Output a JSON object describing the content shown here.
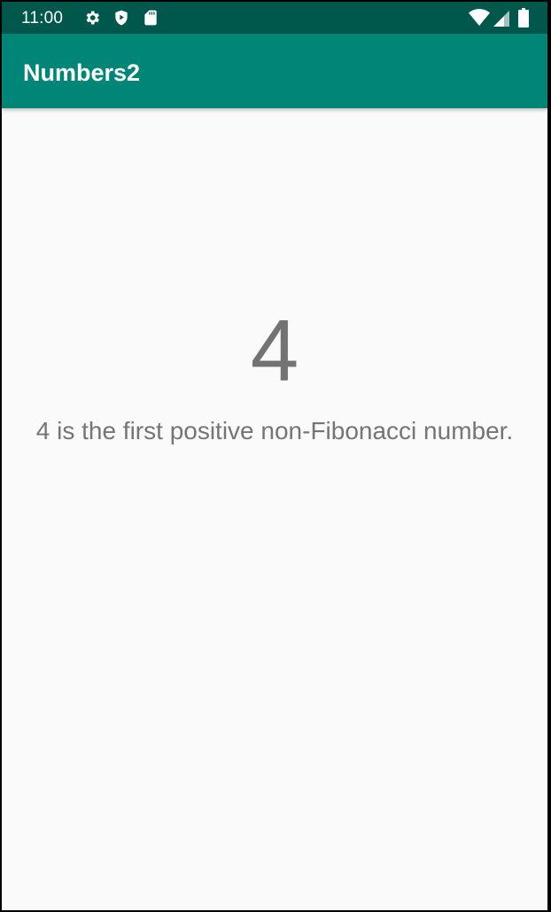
{
  "status_bar": {
    "time": "11:00",
    "icons": [
      "settings-icon",
      "shield-play-icon",
      "sd-card-icon",
      "wifi-icon",
      "signal-icon",
      "battery-icon"
    ]
  },
  "app_bar": {
    "title": "Numbers2"
  },
  "main": {
    "number": "4",
    "description": "4 is the first positive non-Fibonacci number."
  },
  "colors": {
    "status_bar": "#00574b",
    "app_bar": "#008577",
    "background": "#fafafa",
    "text_gray": "#757575"
  }
}
